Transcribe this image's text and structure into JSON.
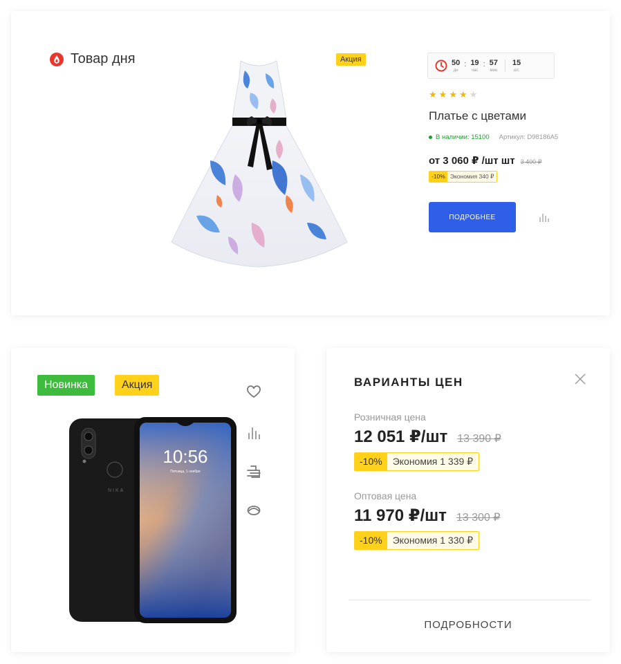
{
  "top_card": {
    "title": "Товар дня",
    "promo_badge": "Акция",
    "timer": {
      "days": "50",
      "days_label": "дн",
      "hours": "19",
      "hours_label": "час",
      "minutes": "57",
      "minutes_label": "мин",
      "count": "15",
      "count_label": "шт."
    },
    "rating": {
      "value": 4,
      "max": 5
    },
    "product_name": "Платье с цветами",
    "stock": "В наличии: 15100",
    "article": "Артикул: D98186A5",
    "price": "от 3 060 ₽ /шт шт",
    "old_price": "3 400 ₽",
    "discount": "-10%",
    "savings": "Экономия 340 ₽",
    "button_label": "ПОДРОБНЕЕ"
  },
  "phone_card": {
    "tag_new": "Новинка",
    "tag_promo": "Акция",
    "phone_time": "10:56",
    "phone_date": "Пятница, 1 ноября",
    "phone_brand": "NIKA"
  },
  "variants_card": {
    "title": "ВАРИАНТЫ ЦЕН",
    "retail": {
      "label": "Розничная цена",
      "price": "12 051 ₽/шт",
      "old_price": "13 390 ₽",
      "discount": "-10%",
      "savings": "Экономия 1 339 ₽"
    },
    "wholesale": {
      "label": "Оптовая цена",
      "price": "11 970 ₽/шт",
      "old_price": "13 300 ₽",
      "discount": "-10%",
      "savings": "Экономия 1 330 ₽"
    },
    "details_label": "ПОДРОБНОСТИ"
  },
  "colors": {
    "accent_blue": "#2f5fe8",
    "promo_yellow": "#ffd11a",
    "new_green": "#3dbb3d",
    "stock_green": "#1a9e2c",
    "drop_red": "#e8362c"
  }
}
